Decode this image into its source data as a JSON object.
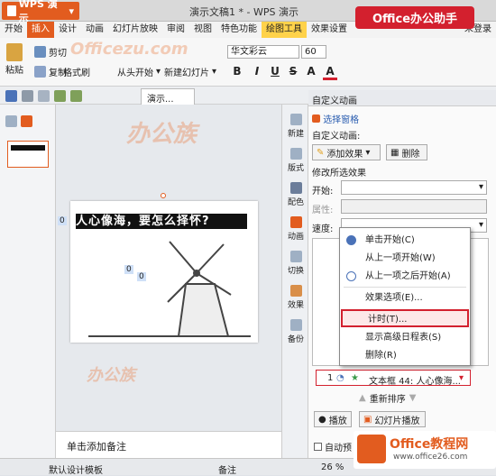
{
  "window": {
    "app_button": "WPS 演示",
    "doc_title": "演示文稿1 * - WPS 演示",
    "badge": "Office办公助手"
  },
  "menu": [
    "开始",
    "插入",
    "设计",
    "动画",
    "幻灯片放映",
    "审阅",
    "视图",
    "特色功能",
    "绘图工具",
    "效果设置",
    "未登录"
  ],
  "menu_active": "插入",
  "ribbon": {
    "paste": "粘贴",
    "cut": "剪切",
    "copy": "复制",
    "format_painter": "格式刷",
    "from_start": "从头开始",
    "new_slide": "新建幻灯片",
    "font": "华文彩云",
    "size": "60",
    "bold": "B",
    "italic": "I",
    "underline": "U",
    "strike": "S",
    "shadow": "A",
    "color": "A"
  },
  "slide_tab": "演示...",
  "thumb_number": "1",
  "slide": {
    "banner": "人心像海，要怎么择怀?",
    "tag0": "0",
    "tag1": "0",
    "tag2": "0"
  },
  "notes": "单击添加备注",
  "status": {
    "template": "默认设计模板",
    "notes_btn": "备注",
    "zoom": "26 %"
  },
  "side_tabs": [
    "新建",
    "版式",
    "配色",
    "动画",
    "切换",
    "效果",
    "备份"
  ],
  "panel": {
    "title": "自定义动画",
    "select_pane": "选择窗格",
    "section_custom": "自定义动画:",
    "add_effect": "添加效果",
    "delete": "删除",
    "section_modify": "修改所选效果",
    "start_label": "开始:",
    "property_label": "属性:",
    "speed_label": "速度:",
    "effect_number": "1",
    "effect_name": "文本框 44: 人心像海...",
    "reorder": "重新排序",
    "play": "播放",
    "slideshow": "幻灯片播放",
    "autopreview": "自动预"
  },
  "context_menu": [
    "单击开始(C)",
    "从上一项开始(W)",
    "从上一项之后开始(A)",
    "效果选项(E)...",
    "计时(T)...",
    "显示高级日程表(S)",
    "删除(R)"
  ],
  "context_menu_highlight": "计时(T)...",
  "watermarks": [
    "Officezu.com",
    "办公族",
    "officezu.com",
    "办公族",
    "office26.com"
  ],
  "logo": {
    "primary": "Office教程网",
    "secondary": "www.office26.com"
  },
  "colors": {
    "accent": "#e25c1f",
    "highlight": "#d3202e",
    "badge": "#d3202e"
  }
}
